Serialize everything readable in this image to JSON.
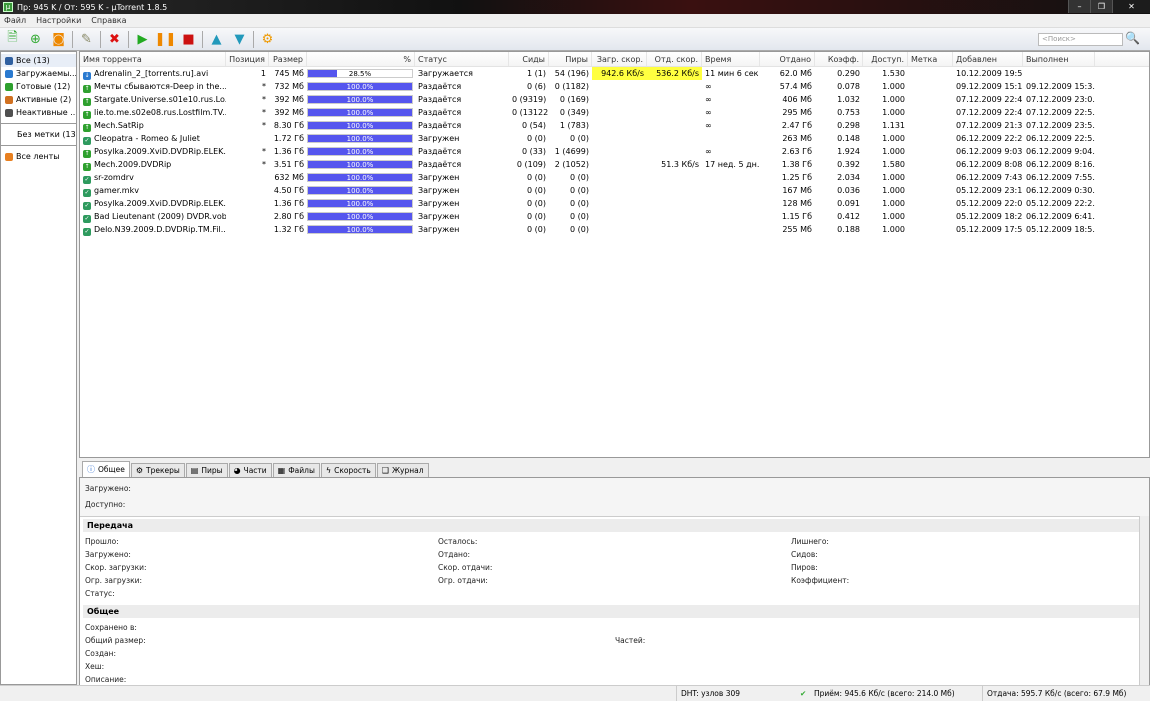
{
  "window": {
    "title": "Пр: 945 K / От: 595 K  - µTorrent 1.8.5",
    "minimize": "–",
    "maximize": "❐",
    "close": "✕"
  },
  "menu": [
    "Файл",
    "Настройки",
    "Справка"
  ],
  "toolbar": {
    "search_placeholder": "<Поиск>"
  },
  "sidebar": {
    "items": [
      {
        "label": "Все (13)",
        "color": "#3060a0"
      },
      {
        "label": "Загружаемы...",
        "color": "#2a7ad0"
      },
      {
        "label": "Готовые (12)",
        "color": "#2ea02e"
      },
      {
        "label": "Активные (2)",
        "color": "#d07020"
      },
      {
        "label": "Неактивные ...",
        "color": "#505050"
      }
    ],
    "no_label": "Без метки (13)",
    "feeds": "Все ленты"
  },
  "columns": [
    "Имя торрента",
    "Позиция",
    "Размер",
    "%",
    "Статус",
    "Сиды",
    "Пиры",
    "Загр. скор.",
    "Отд. скор.",
    "Время",
    "Отдано",
    "Коэфф.",
    "Доступ.",
    "Метка",
    "Добавлен",
    "Выполнен"
  ],
  "torrents": [
    {
      "name": "Adrenalin_2_[torrents.ru].avi",
      "pos": "1",
      "size": "745 Мб",
      "pct": 28.5,
      "pct_label": "28.5%",
      "status": "Загружается",
      "seeds": "1 (1)",
      "peers": "54 (196)",
      "down": "942.6 Кб/s",
      "up": "536.2 Кб/s",
      "eta": "11 мин 6 сек",
      "uploaded": "62.0 Мб",
      "ratio": "0.290",
      "avail": "1.530",
      "label": "",
      "added": "10.12.2009 19:5...",
      "done": "",
      "icon": "down"
    },
    {
      "name": "Мечты сбываются-Deep in the...",
      "pos": "*",
      "size": "732 Мб",
      "pct": 100,
      "pct_label": "100.0%",
      "status": "Раздаётся",
      "seeds": "0 (6)",
      "peers": "0 (1182)",
      "down": "",
      "up": "",
      "eta": "∞",
      "uploaded": "57.4 Мб",
      "ratio": "0.078",
      "avail": "1.000",
      "label": "",
      "added": "09.12.2009 15:1...",
      "done": "09.12.2009 15:3...",
      "icon": "seed"
    },
    {
      "name": "Stargate.Universe.s01e10.rus.Lo...",
      "pos": "*",
      "size": "392 Мб",
      "pct": 100,
      "pct_label": "100.0%",
      "status": "Раздаётся",
      "seeds": "0 (9319)",
      "peers": "0 (169)",
      "down": "",
      "up": "",
      "eta": "∞",
      "uploaded": "406 Мб",
      "ratio": "1.032",
      "avail": "1.000",
      "label": "",
      "added": "07.12.2009 22:4...",
      "done": "07.12.2009 23:0...",
      "icon": "seed"
    },
    {
      "name": "lie.to.me.s02e08.rus.Lostfilm.TV...",
      "pos": "*",
      "size": "392 Мб",
      "pct": 100,
      "pct_label": "100.0%",
      "status": "Раздаётся",
      "seeds": "0 (13122)",
      "peers": "0 (349)",
      "down": "",
      "up": "",
      "eta": "∞",
      "uploaded": "295 Мб",
      "ratio": "0.753",
      "avail": "1.000",
      "label": "",
      "added": "07.12.2009 22:4...",
      "done": "07.12.2009 22:5...",
      "icon": "seed"
    },
    {
      "name": "Mech.SatRip",
      "pos": "*",
      "size": "8.30 Гб",
      "pct": 100,
      "pct_label": "100.0%",
      "status": "Раздаётся",
      "seeds": "0 (54)",
      "peers": "1 (783)",
      "down": "",
      "up": "",
      "eta": "∞",
      "uploaded": "2.47 Гб",
      "ratio": "0.298",
      "avail": "1.131",
      "label": "",
      "added": "07.12.2009 21:3...",
      "done": "07.12.2009 23:5...",
      "icon": "seed"
    },
    {
      "name": "Cleopatra - Romeo & Juliet",
      "pos": "",
      "size": "1.72 Гб",
      "pct": 100,
      "pct_label": "100.0%",
      "status": "Загружен",
      "seeds": "0 (0)",
      "peers": "0 (0)",
      "down": "",
      "up": "",
      "eta": "",
      "uploaded": "263 Мб",
      "ratio": "0.148",
      "avail": "1.000",
      "label": "",
      "added": "06.12.2009 22:2...",
      "done": "06.12.2009 22:5...",
      "icon": "done"
    },
    {
      "name": "Posylka.2009.XviD.DVDRip.ELEK...",
      "pos": "*",
      "size": "1.36 Гб",
      "pct": 100,
      "pct_label": "100.0%",
      "status": "Раздаётся",
      "seeds": "0 (33)",
      "peers": "1 (4699)",
      "down": "",
      "up": "",
      "eta": "∞",
      "uploaded": "2.63 Гб",
      "ratio": "1.924",
      "avail": "1.000",
      "label": "",
      "added": "06.12.2009 9:03...",
      "done": "06.12.2009 9:04...",
      "icon": "seed"
    },
    {
      "name": "Mech.2009.DVDRip",
      "pos": "*",
      "size": "3.51 Гб",
      "pct": 100,
      "pct_label": "100.0%",
      "status": "Раздаётся",
      "seeds": "0 (109)",
      "peers": "2 (1052)",
      "down": "",
      "up": "51.3 Кб/s",
      "eta": "17 нед. 5 дн.",
      "uploaded": "1.38 Гб",
      "ratio": "0.392",
      "avail": "1.580",
      "label": "",
      "added": "06.12.2009 8:08...",
      "done": "06.12.2009 8:16...",
      "icon": "seed"
    },
    {
      "name": "sr-zomdrv",
      "pos": "",
      "size": "632 Мб",
      "pct": 100,
      "pct_label": "100.0%",
      "status": "Загружен",
      "seeds": "0 (0)",
      "peers": "0 (0)",
      "down": "",
      "up": "",
      "eta": "",
      "uploaded": "1.25 Гб",
      "ratio": "2.034",
      "avail": "1.000",
      "label": "",
      "added": "06.12.2009 7:43...",
      "done": "06.12.2009 7:55...",
      "icon": "done"
    },
    {
      "name": "gamer.mkv",
      "pos": "",
      "size": "4.50 Гб",
      "pct": 100,
      "pct_label": "100.0%",
      "status": "Загружен",
      "seeds": "0 (0)",
      "peers": "0 (0)",
      "down": "",
      "up": "",
      "eta": "",
      "uploaded": "167 Мб",
      "ratio": "0.036",
      "avail": "1.000",
      "label": "",
      "added": "05.12.2009 23:1...",
      "done": "06.12.2009 0:30...",
      "icon": "done"
    },
    {
      "name": "Posylka.2009.XviD.DVDRip.ELEK...",
      "pos": "",
      "size": "1.36 Гб",
      "pct": 100,
      "pct_label": "100.0%",
      "status": "Загружен",
      "seeds": "0 (0)",
      "peers": "0 (0)",
      "down": "",
      "up": "",
      "eta": "",
      "uploaded": "128 Мб",
      "ratio": "0.091",
      "avail": "1.000",
      "label": "",
      "added": "05.12.2009 22:0...",
      "done": "05.12.2009 22:2...",
      "icon": "done"
    },
    {
      "name": "Bad Lieutenant (2009) DVDR.vob",
      "pos": "",
      "size": "2.80 Гб",
      "pct": 100,
      "pct_label": "100.0%",
      "status": "Загружен",
      "seeds": "0 (0)",
      "peers": "0 (0)",
      "down": "",
      "up": "",
      "eta": "",
      "uploaded": "1.15 Гб",
      "ratio": "0.412",
      "avail": "1.000",
      "label": "",
      "added": "05.12.2009 18:2...",
      "done": "06.12.2009 6:41...",
      "icon": "done"
    },
    {
      "name": "Delo.N39.2009.D.DVDRip.TM.Fil...",
      "pos": "",
      "size": "1.32 Гб",
      "pct": 100,
      "pct_label": "100.0%",
      "status": "Загружен",
      "seeds": "0 (0)",
      "peers": "0 (0)",
      "down": "",
      "up": "",
      "eta": "",
      "uploaded": "255 Мб",
      "ratio": "0.188",
      "avail": "1.000",
      "label": "",
      "added": "05.12.2009 17:5...",
      "done": "05.12.2009 18:5...",
      "icon": "done"
    }
  ],
  "tabs": [
    {
      "label": "Общее",
      "icon": "ⓘ"
    },
    {
      "label": "Трекеры",
      "icon": "⚙"
    },
    {
      "label": "Пиры",
      "icon": "▤"
    },
    {
      "label": "Части",
      "icon": "◕"
    },
    {
      "label": "Файлы",
      "icon": "▦"
    },
    {
      "label": "Скорость",
      "icon": "ϟ"
    },
    {
      "label": "Журнал",
      "icon": "❑"
    }
  ],
  "details": {
    "downloaded": "Загружено:",
    "available": "Доступно:",
    "transfer_title": "Передача",
    "transfer": [
      [
        "Прошло:",
        "Осталось:",
        "Лишнего:"
      ],
      [
        "Загружено:",
        "Отдано:",
        "Сидов:"
      ],
      [
        "Скор. загрузки:",
        "Скор. отдачи:",
        "Пиров:"
      ],
      [
        "Огр. загрузки:",
        "Огр. отдачи:",
        "Коэффициент:"
      ],
      [
        "Статус:",
        "",
        ""
      ]
    ],
    "general_title": "Общее",
    "general": [
      "Сохранено в:",
      "Общий размер:",
      "Создан:",
      "Хеш:",
      "Описание:"
    ],
    "pieces": "Частей:"
  },
  "status": {
    "dht": "DHT: узлов 309",
    "down": "Приём: 945.6 Кб/с (всего: 214.0 Мб)",
    "up": "Отдача: 595.7 Кб/с (всего: 67.9 Мб)"
  }
}
